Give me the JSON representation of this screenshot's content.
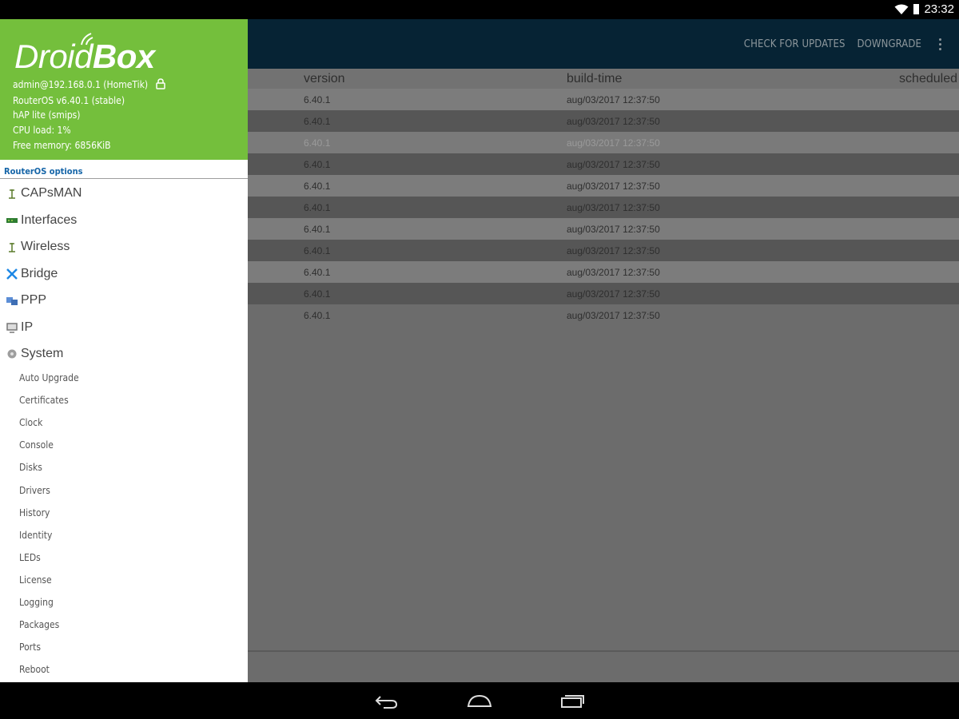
{
  "status_bar": {
    "time": "23:32"
  },
  "actionbar": {
    "check_updates": "CHECK FOR UPDATES",
    "downgrade": "DOWNGRADE"
  },
  "table": {
    "columns": [
      "version",
      "build-time",
      "scheduled"
    ],
    "rows": [
      {
        "version": "6.40.1",
        "build_time": "aug/03/2017 12:37:50"
      },
      {
        "version": "6.40.1",
        "build_time": "aug/03/2017 12:37:50"
      },
      {
        "version": "6.40.1",
        "build_time": "aug/03/2017 12:37:50"
      },
      {
        "version": "6.40.1",
        "build_time": "aug/03/2017 12:37:50"
      },
      {
        "version": "6.40.1",
        "build_time": "aug/03/2017 12:37:50"
      },
      {
        "version": "6.40.1",
        "build_time": "aug/03/2017 12:37:50"
      },
      {
        "version": "6.40.1",
        "build_time": "aug/03/2017 12:37:50"
      },
      {
        "version": "6.40.1",
        "build_time": "aug/03/2017 12:37:50"
      },
      {
        "version": "6.40.1",
        "build_time": "aug/03/2017 12:37:50"
      },
      {
        "version": "6.40.1",
        "build_time": "aug/03/2017 12:37:50"
      },
      {
        "version": "6.40.1",
        "build_time": "aug/03/2017 12:37:50"
      }
    ]
  },
  "drawer": {
    "logo_droid": "Droid",
    "logo_box": "Box",
    "account": "admin@192.168.0.1 (HomeTik)",
    "routeros": "RouterOS v6.40.1 (stable)",
    "board": "hAP lite (smips)",
    "cpu_load": "CPU load: 1%",
    "free_memory": "Free memory: 6856KiB",
    "section_title": "RouterOS options",
    "menu": [
      {
        "label": "CAPsMAN",
        "icon": "antenna-icon"
      },
      {
        "label": "Interfaces",
        "icon": "interfaces-icon"
      },
      {
        "label": "Wireless",
        "icon": "wireless-icon"
      },
      {
        "label": "Bridge",
        "icon": "bridge-icon"
      },
      {
        "label": "PPP",
        "icon": "ppp-icon"
      },
      {
        "label": "IP",
        "icon": "ip-icon"
      },
      {
        "label": "System",
        "icon": "system-icon"
      }
    ],
    "system_items": [
      "Auto Upgrade",
      "Certificates",
      "Clock",
      "Console",
      "Disks",
      "Drivers",
      "History",
      "Identity",
      "LEDs",
      "License",
      "Logging",
      "Packages",
      "Ports",
      "Reboot"
    ]
  },
  "colors": {
    "drawer_header": "#74bf3c",
    "actionbar": "#062334",
    "section_title": "#1565a8"
  }
}
